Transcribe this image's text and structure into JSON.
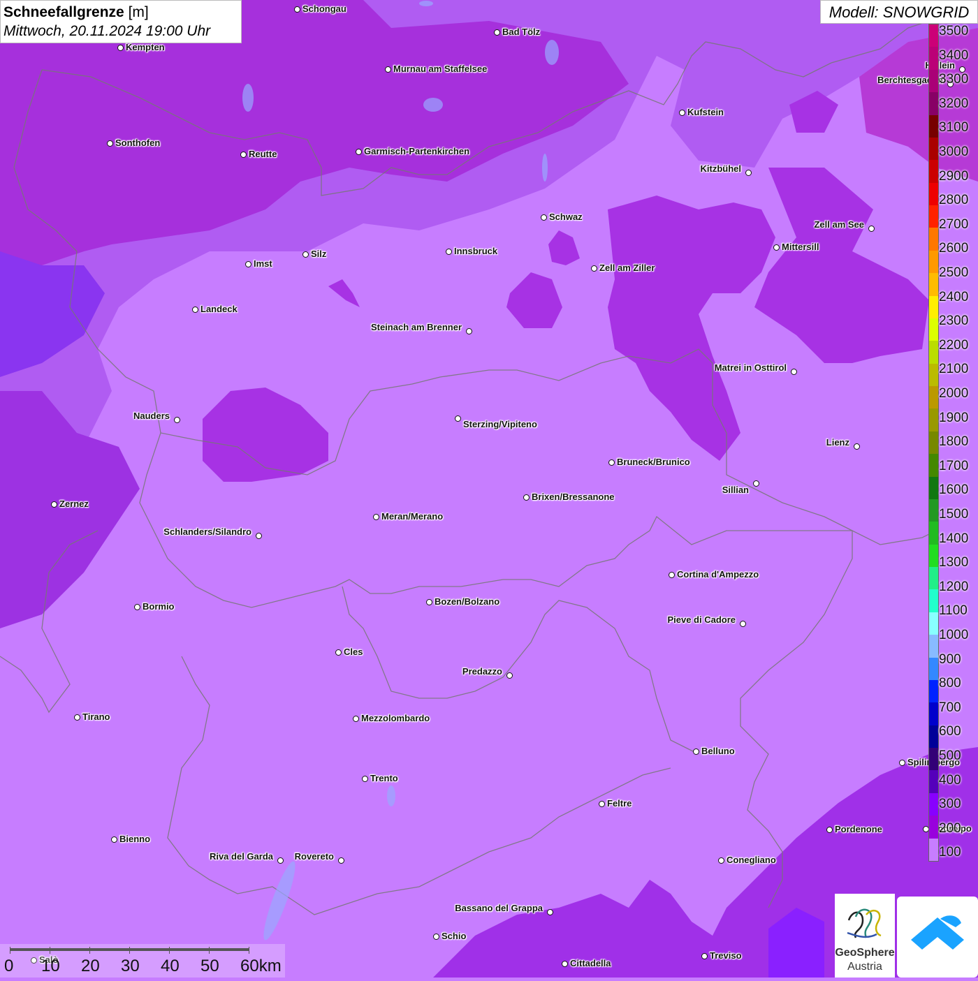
{
  "title": {
    "main": "Schneefallgrenze",
    "unit": "[m]",
    "date": "Mittwoch, 20.11.2024 19:00 Uhr"
  },
  "model": "Modell: SNOWGRID",
  "cities": [
    {
      "name": "Schongau"
    },
    {
      "name": "Bad Tölz"
    },
    {
      "name": "Kempten"
    },
    {
      "name": "Murnau am Staffelsee"
    },
    {
      "name": "Kufstein"
    },
    {
      "name": "Berchtesgaden"
    },
    {
      "name": "Sonthofen"
    },
    {
      "name": "Reutte"
    },
    {
      "name": "Garmisch-Partenkirchen"
    },
    {
      "name": "Kitzbühel"
    },
    {
      "name": "Schwaz"
    },
    {
      "name": "Zell am See"
    },
    {
      "name": "Innsbruck"
    },
    {
      "name": "Silz"
    },
    {
      "name": "Imst"
    },
    {
      "name": "Mittersill"
    },
    {
      "name": "Zell am Ziller"
    },
    {
      "name": "Landeck"
    },
    {
      "name": "Steinach am Brenner"
    },
    {
      "name": "Matrei in Osttirol"
    },
    {
      "name": "Nauders"
    },
    {
      "name": "Sterzing/Vipiteno"
    },
    {
      "name": "Lienz"
    },
    {
      "name": "Bruneck/Brunico"
    },
    {
      "name": "Sillian"
    },
    {
      "name": "Zernez"
    },
    {
      "name": "Brixen/Bressanone"
    },
    {
      "name": "Meran/Merano"
    },
    {
      "name": "Schlanders/Silandro"
    },
    {
      "name": "Cortina d'Ampezzo"
    },
    {
      "name": "Bozen/Bolzano"
    },
    {
      "name": "Bormio"
    },
    {
      "name": "Pieve di Cadore"
    },
    {
      "name": "Cles"
    },
    {
      "name": "Predazzo"
    },
    {
      "name": "Tirano"
    },
    {
      "name": "Mezzolombardo"
    },
    {
      "name": "Belluno"
    },
    {
      "name": "Spilimbergo"
    },
    {
      "name": "Trento"
    },
    {
      "name": "Feltre"
    },
    {
      "name": "Pordenone"
    },
    {
      "name": "Bienno"
    },
    {
      "name": "Riva del Garda"
    },
    {
      "name": "Rovereto"
    },
    {
      "name": "Conegliano"
    },
    {
      "name": "Bassano del Grappa"
    },
    {
      "name": "Schio"
    },
    {
      "name": "Treviso"
    },
    {
      "name": "Cittadella"
    },
    {
      "name": "Hallein"
    },
    {
      "name": "Codroipo"
    },
    {
      "name": "Salò"
    }
  ],
  "legend": {
    "labels": [
      "3500",
      "3400",
      "3300",
      "3200",
      "3100",
      "3000",
      "2900",
      "2800",
      "2700",
      "2600",
      "2500",
      "2400",
      "2300",
      "2200",
      "2100",
      "2000",
      "1900",
      "1800",
      "1700",
      "1600",
      "1500",
      "1400",
      "1300",
      "1200",
      "1100",
      "1000",
      "900",
      "800",
      "700",
      "600",
      "500",
      "400",
      "300",
      "200",
      "100"
    ],
    "colors": [
      "#cc0077",
      "#bb0077",
      "#aa0077",
      "#880066",
      "#770000",
      "#aa0000",
      "#cc0000",
      "#ee0000",
      "#ff2200",
      "#ff7700",
      "#ff9900",
      "#ffbb00",
      "#ffee00",
      "#ddff00",
      "#bbdd00",
      "#bbbb00",
      "#bb9900",
      "#999900",
      "#778800",
      "#448800",
      "#117711",
      "#229922",
      "#22bb22",
      "#22dd22",
      "#22ee88",
      "#22ffcc",
      "#88ffff",
      "#88bbff",
      "#3388ff",
      "#0022ff",
      "#0000cc",
      "#000099",
      "#330077",
      "#5500bb",
      "#8800ff",
      "#9900dd",
      "#c77dff"
    ]
  },
  "scale": {
    "labels": [
      "0",
      "10",
      "20",
      "30",
      "40",
      "50",
      "60km"
    ]
  },
  "logo": {
    "line1": "GeoSphere",
    "line2": "Austria"
  },
  "map_colors": {
    "base": "#c77dff",
    "mid": "#b35cf0",
    "dark": "#9a2ee0",
    "deep": "#8a35f0",
    "magenta": "#a81fd8"
  }
}
